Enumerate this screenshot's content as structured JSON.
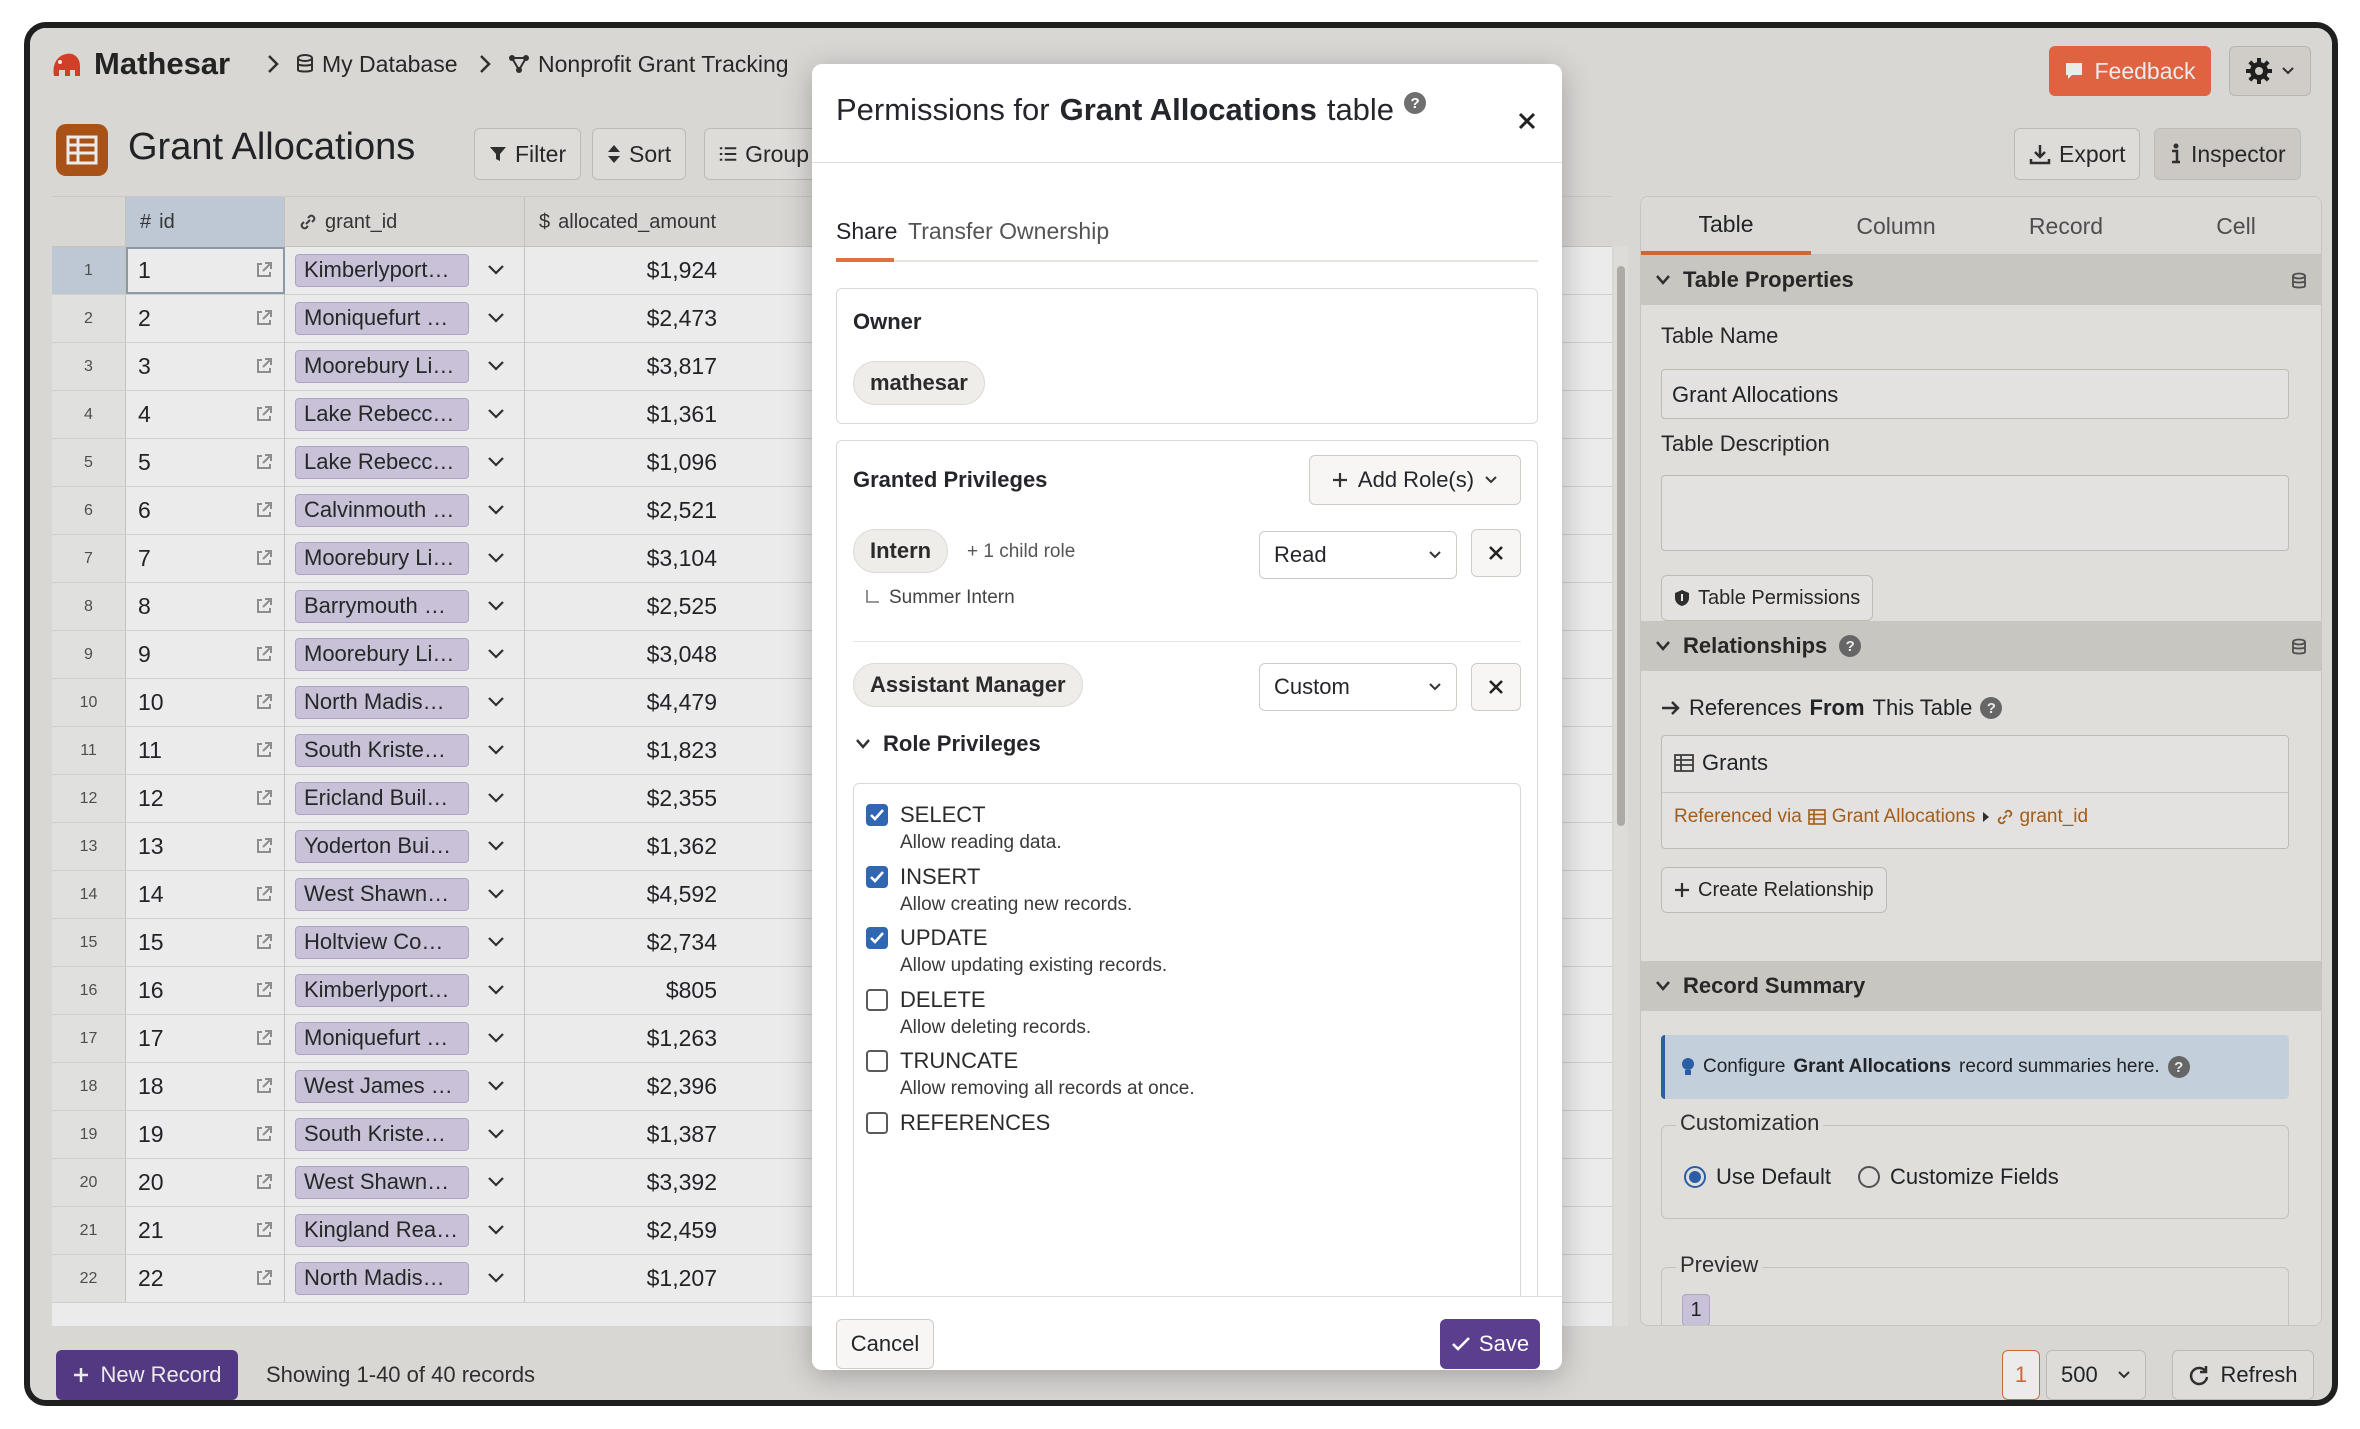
{
  "app": {
    "name": "Mathesar"
  },
  "breadcrumbs": [
    {
      "label": "My Database",
      "icon": "database-icon"
    },
    {
      "label": "Nonprofit Grant Tracking",
      "icon": "schema-icon"
    }
  ],
  "topbar": {
    "feedback_label": "Feedback"
  },
  "table": {
    "title": "Grant Allocations",
    "toolbar": {
      "filter": "Filter",
      "sort": "Sort",
      "group": "Group",
      "export": "Export",
      "inspector": "Inspector"
    }
  },
  "grid": {
    "columns": [
      {
        "name": "id",
        "icon": "#"
      },
      {
        "name": "grant_id",
        "icon": "link-icon"
      },
      {
        "name": "allocated_amount",
        "icon": "$"
      }
    ],
    "rows": [
      {
        "n": "1",
        "id": "1",
        "grant": "Kimberlyport…",
        "amount": "$1,924"
      },
      {
        "n": "2",
        "id": "2",
        "grant": "Moniquefurt …",
        "amount": "$2,473"
      },
      {
        "n": "3",
        "id": "3",
        "grant": "Moorebury Li…",
        "amount": "$3,817"
      },
      {
        "n": "4",
        "id": "4",
        "grant": "Lake Rebecca…",
        "amount": "$1,361"
      },
      {
        "n": "5",
        "id": "5",
        "grant": "Lake Rebecca…",
        "amount": "$1,096"
      },
      {
        "n": "6",
        "id": "6",
        "grant": "Calvinmouth …",
        "amount": "$2,521"
      },
      {
        "n": "7",
        "id": "7",
        "grant": "Moorebury Li…",
        "amount": "$3,104"
      },
      {
        "n": "8",
        "id": "8",
        "grant": "Barrymouth …",
        "amount": "$2,525"
      },
      {
        "n": "9",
        "id": "9",
        "grant": "Moorebury Li…",
        "amount": "$3,048"
      },
      {
        "n": "10",
        "id": "10",
        "grant": "North Madis…",
        "amount": "$4,479"
      },
      {
        "n": "11",
        "id": "11",
        "grant": "South Kriste…",
        "amount": "$1,823"
      },
      {
        "n": "12",
        "id": "12",
        "grant": "Ericland Buil…",
        "amount": "$2,355"
      },
      {
        "n": "13",
        "id": "13",
        "grant": "Yoderton Bui…",
        "amount": "$1,362"
      },
      {
        "n": "14",
        "id": "14",
        "grant": "West Shawn…",
        "amount": "$4,592"
      },
      {
        "n": "15",
        "id": "15",
        "grant": "Holtview Co…",
        "amount": "$2,734"
      },
      {
        "n": "16",
        "id": "16",
        "grant": "Kimberlyport…",
        "amount": "$805"
      },
      {
        "n": "17",
        "id": "17",
        "grant": "Moniquefurt …",
        "amount": "$1,263"
      },
      {
        "n": "18",
        "id": "18",
        "grant": "West James …",
        "amount": "$2,396"
      },
      {
        "n": "19",
        "id": "19",
        "grant": "South Kriste…",
        "amount": "$1,387"
      },
      {
        "n": "20",
        "id": "20",
        "grant": "West Shawn…",
        "amount": "$3,392"
      },
      {
        "n": "21",
        "id": "21",
        "grant": "Kingland Rea…",
        "amount": "$2,459"
      },
      {
        "n": "22",
        "id": "22",
        "grant": "North Madis…",
        "amount": "$1,207"
      }
    ]
  },
  "footer": {
    "new_record": "New Record",
    "showing": "Showing 1-40 of 40 records",
    "page": "1",
    "page_size": "500",
    "refresh": "Refresh"
  },
  "inspector": {
    "tabs": [
      "Table",
      "Column",
      "Record",
      "Cell"
    ],
    "active_tab": "Table",
    "table_properties": "Table Properties",
    "table_name_label": "Table Name",
    "table_name_value": "Grant Allocations",
    "table_description_label": "Table Description",
    "table_permissions_btn": "Table Permissions",
    "relationships": "Relationships",
    "references_prefix": "References",
    "references_from": "From",
    "references_suffix": "This Table",
    "ref_table": "Grants",
    "referenced_via": "Referenced via",
    "ref_via_table": "Grant Allocations",
    "ref_via_column": "grant_id",
    "create_relationship": "Create Relationship",
    "record_summary": "Record Summary",
    "configure_prefix": "Configure",
    "configure_table": "Grant Allocations",
    "configure_suffix": "record summaries here.",
    "customization": "Customization",
    "use_default": "Use Default",
    "customize_fields": "Customize Fields",
    "preview": "Preview",
    "preview_value": "1"
  },
  "modal": {
    "title_prefix": "Permissions for",
    "title_table": "Grant Allocations",
    "title_suffix": "table",
    "tabs": [
      "Share",
      "Transfer Ownership"
    ],
    "active_tab": "Share",
    "owner_label": "Owner",
    "owner_value": "mathesar",
    "granted_privileges": "Granted Privileges",
    "add_roles": "Add Role(s)",
    "role1": {
      "name": "Intern",
      "child_note": "+ 1 child role",
      "child": "Summer Intern",
      "access": "Read"
    },
    "role2": {
      "name": "Assistant Manager",
      "access": "Custom"
    },
    "role_privileges": "Role Privileges",
    "privileges": [
      {
        "name": "SELECT",
        "desc": "Allow reading data.",
        "checked": true
      },
      {
        "name": "INSERT",
        "desc": "Allow creating new records.",
        "checked": true
      },
      {
        "name": "UPDATE",
        "desc": "Allow updating existing records.",
        "checked": true
      },
      {
        "name": "DELETE",
        "desc": "Allow deleting records.",
        "checked": false
      },
      {
        "name": "TRUNCATE",
        "desc": "Allow removing all records at once.",
        "checked": false
      },
      {
        "name": "REFERENCES",
        "desc": "",
        "checked": false
      }
    ],
    "cancel": "Cancel",
    "save": "Save"
  },
  "colors": {
    "accent": "#e0703d",
    "feedback": "#f26b47",
    "primary": "#5b3e8e",
    "checkbox": "#2f67b2",
    "table_icon": "#b85a1b"
  }
}
